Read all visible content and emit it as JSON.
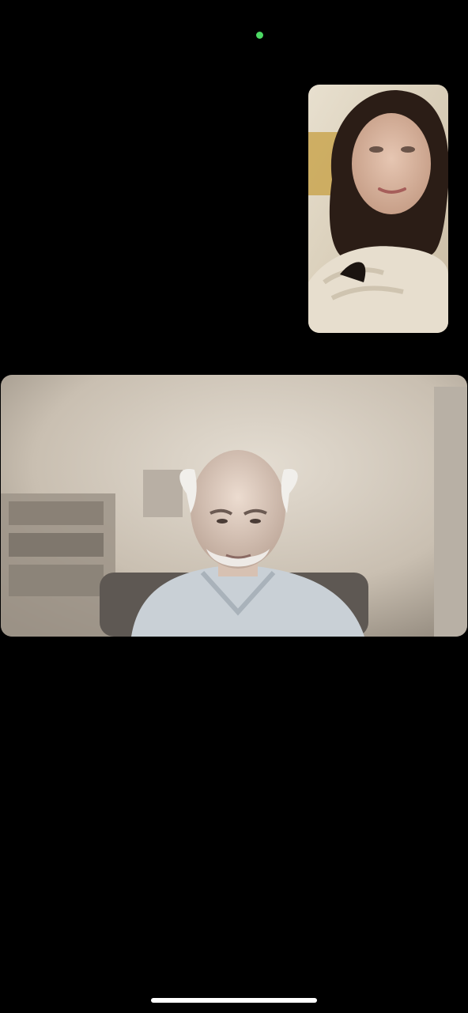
{
  "status_bar": {
    "camera_indicator_color": "#4cd964"
  },
  "call": {
    "self_view": {
      "icon": "person-video-icon"
    },
    "remote_participant": {
      "icon": "person-video-icon"
    }
  },
  "home_indicator": {
    "color": "#ffffff"
  }
}
